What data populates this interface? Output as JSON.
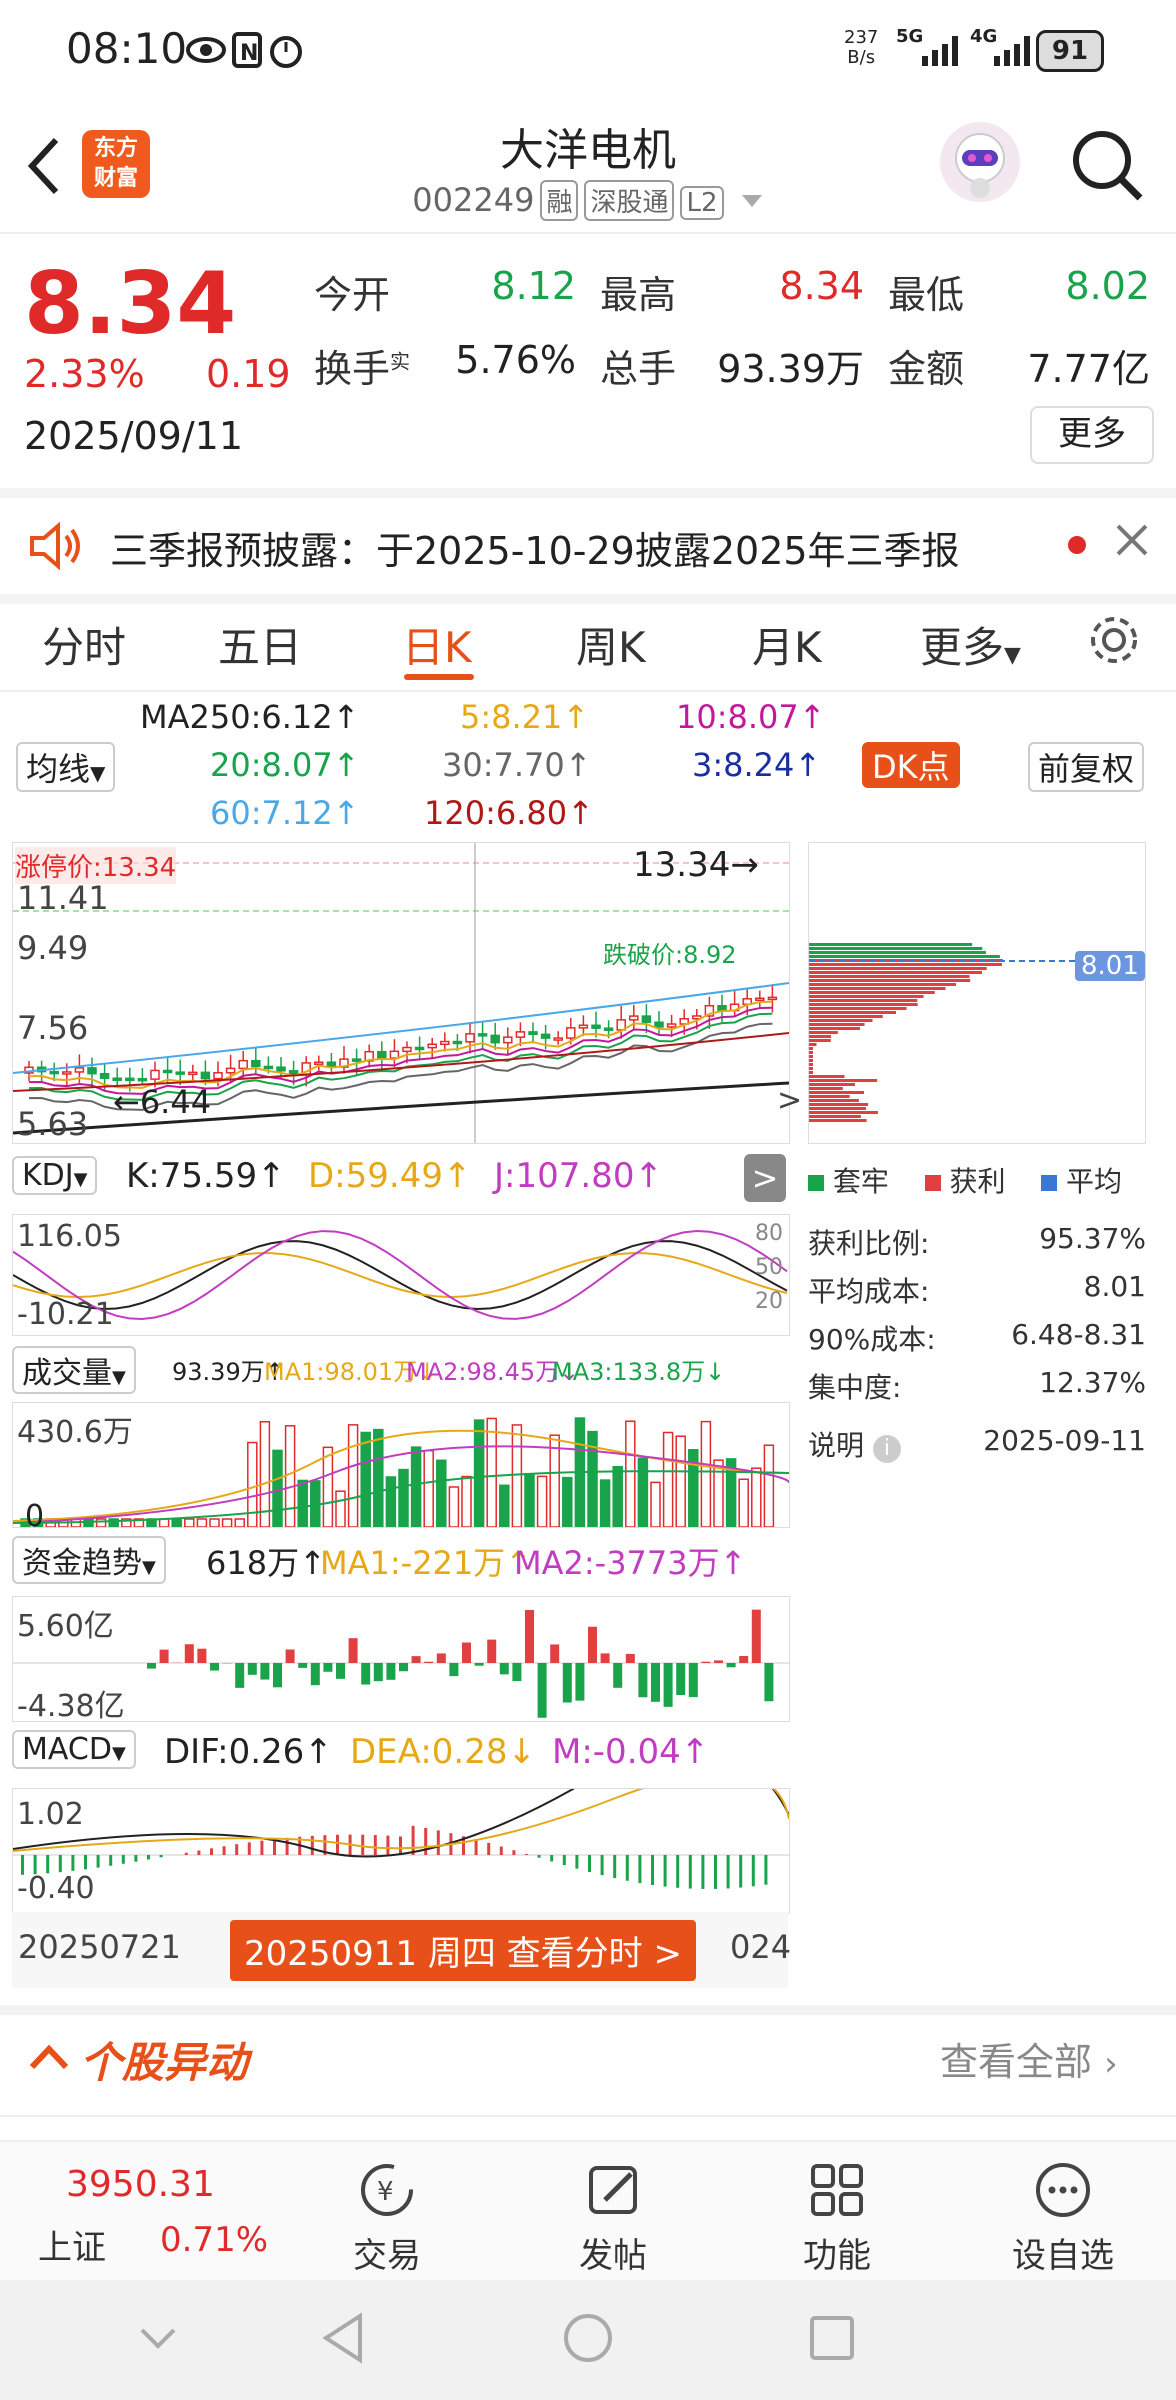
{
  "status_bar": {
    "time": "08:10",
    "net_speed": "237\nB/s",
    "net_speed_top": "237",
    "net_speed_bottom": "B/s",
    "signal1": "5G",
    "signal2": "4G",
    "battery": "91"
  },
  "header": {
    "logo_top": "东方",
    "logo_bottom": "财富",
    "stock_name": "大洋电机",
    "stock_code": "002249",
    "tag1": "融",
    "tag2": "深股通",
    "tag3": "L2"
  },
  "quote": {
    "price": "8.34",
    "change_pct": "2.33%",
    "change_amt": "0.19",
    "date": "2025/09/11",
    "open_label": "今开",
    "open": "8.12",
    "high_label": "最高",
    "high": "8.34",
    "low_label": "最低",
    "low": "8.02",
    "turnover_label": "换手",
    "turnover_sup": "实",
    "turnover": "5.76%",
    "volume_label": "总手",
    "volume": "93.39万",
    "amount_label": "金额",
    "amount": "7.77亿",
    "more": "更多"
  },
  "notice": {
    "text": "三季报预披露：于2025-10-29披露2025年三季报"
  },
  "tabs": [
    {
      "label": "分时"
    },
    {
      "label": "五日"
    },
    {
      "label": "日K"
    },
    {
      "label": "周K"
    },
    {
      "label": "月K"
    },
    {
      "label": "更多"
    }
  ],
  "chart": {
    "ma_button": "均线",
    "ma250": "MA250:6.12↑",
    "ma5": "5:8.21↑",
    "ma10": "10:8.07↑",
    "ma20": "20:8.07↑",
    "ma30": "30:7.70↑",
    "ma3": "3:8.24↑",
    "ma60": "60:7.12↑",
    "ma120": "120:6.80↑",
    "dk_button": "DK点",
    "adjust_button": "前复权",
    "limit_up": "涨停价:13.34",
    "y_labels": [
      "11.41",
      "9.49",
      "7.56",
      "5.63"
    ],
    "price_right": "13.34",
    "min_label": "6.44",
    "support_label": "跌破价:8.92",
    "kdj_button": "KDJ",
    "kdj_k": "K:75.59↑",
    "kdj_d": "D:59.49↑",
    "kdj_j": "J:107.80↑",
    "kdj_high": "116.05",
    "kdj_low": "-10.21",
    "kdj_levels": [
      "80",
      "50",
      "20"
    ],
    "vol_button": "成交量",
    "vol_now": "93.39万↑",
    "vol_ma1": "MA1:98.01万↓",
    "vol_ma2": "MA2:98.45万↓",
    "vol_ma3": "MA3:133.8万↓",
    "vol_high": "430.6万",
    "vol_low": "0",
    "fund_button": "资金趋势",
    "fund_now": "618万↑",
    "fund_ma1": "MA1:-221万↑",
    "fund_ma2": "MA2:-3773万↑",
    "fund_high": "5.60亿",
    "fund_low": "-4.38亿",
    "macd_button": "MACD",
    "macd_dif": "DIF:0.26↑",
    "macd_dea": "DEA:0.28↓",
    "macd_m": "M:-0.04↑",
    "macd_high": "1.02",
    "macd_low": "-0.40",
    "date_start": "20250721",
    "date_end": "024",
    "date_tip": "20250911 周四 查看分时 >"
  },
  "chip": {
    "current": "8.01",
    "legend1": "套牢",
    "legend2": "获利",
    "legend3": "平均",
    "ratio_label": "获利比例:",
    "ratio": "95.37%",
    "avg_label": "平均成本:",
    "avg": "8.01",
    "cost90_label": "90%成本:",
    "cost90": "6.48-8.31",
    "concentration_label": "集中度:",
    "concentration": "12.37%",
    "note_label": "说明",
    "note_date": "2025-09-11",
    "colors": {
      "trapped": "#19a34a",
      "profit": "#e04040",
      "avg": "#3a78d8"
    }
  },
  "section": {
    "title": "个股异动",
    "view_all": "查看全部"
  },
  "bottom_nav": {
    "index_value": "3950.31",
    "index_name": "上证",
    "index_change": "0.71%",
    "items": [
      {
        "label": "交易",
        "icon": "yuan-cycle-icon"
      },
      {
        "label": "发帖",
        "icon": "edit-icon"
      },
      {
        "label": "功能",
        "icon": "grid-icon"
      },
      {
        "label": "设自选",
        "icon": "more-circle-icon"
      }
    ]
  }
}
